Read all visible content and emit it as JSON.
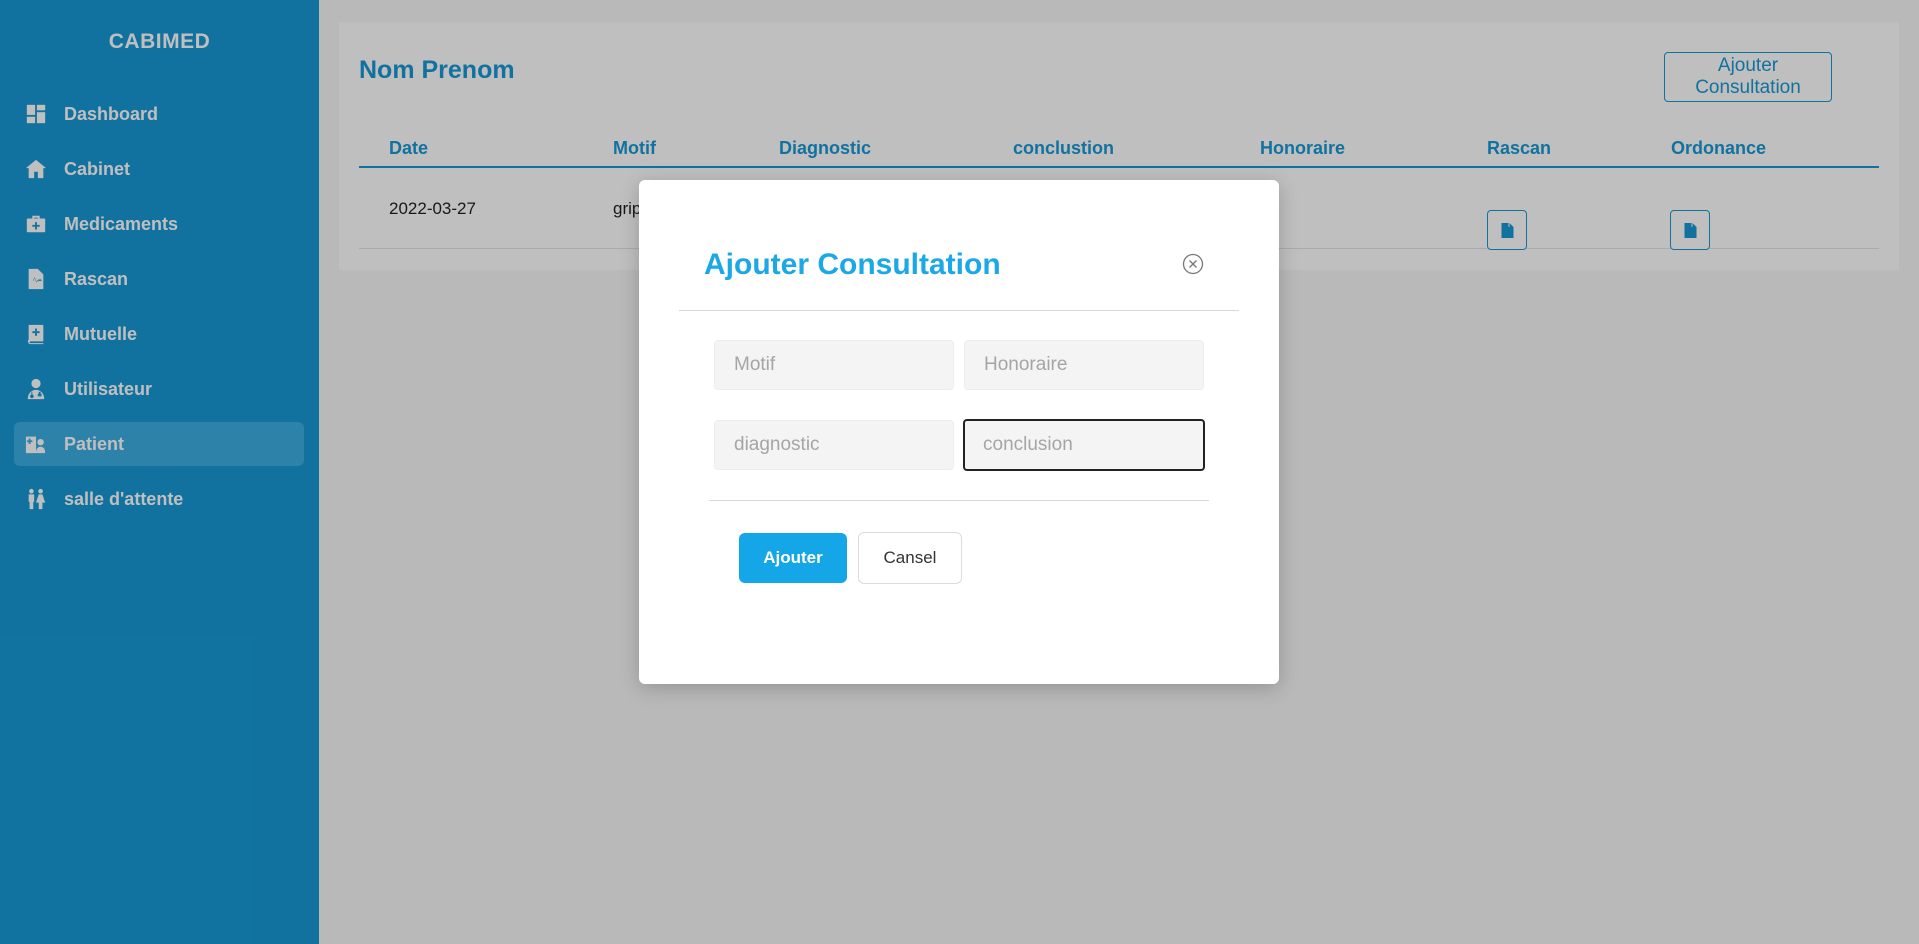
{
  "sidebar": {
    "brand": "CABIMED",
    "items": [
      {
        "label": "Dashboard",
        "icon": "dashboard-icon"
      },
      {
        "label": "Cabinet",
        "icon": "home-icon"
      },
      {
        "label": "Medicaments",
        "icon": "medkit-icon"
      },
      {
        "label": "Rascan",
        "icon": "file-medical-icon"
      },
      {
        "label": "Mutuelle",
        "icon": "book-medical-icon"
      },
      {
        "label": "Utilisateur",
        "icon": "user-doctor-icon"
      },
      {
        "label": "Patient",
        "icon": "hospital-user-icon",
        "active": true
      },
      {
        "label": "salle d'attente",
        "icon": "people-icon"
      }
    ]
  },
  "main": {
    "title": "Nom Prenom",
    "add_button": "Ajouter Consultation",
    "table": {
      "headers": [
        "Date",
        "Motif",
        "Diagnostic",
        "conclustion",
        "Honoraire",
        "Rascan",
        "Ordonance"
      ],
      "rows": [
        {
          "date": "2022-03-27",
          "motif": "gripe"
        }
      ]
    }
  },
  "modal": {
    "title": "Ajouter Consultation",
    "fields": {
      "motif_placeholder": "Motif",
      "honoraire_placeholder": "Honoraire",
      "diagnostic_placeholder": "diagnostic",
      "conclusion_placeholder": "conclusion"
    },
    "submit_label": "Ajouter",
    "cancel_label": "Cansel"
  },
  "colors": {
    "primary": "#1799d6",
    "accent": "#14a6e6"
  }
}
